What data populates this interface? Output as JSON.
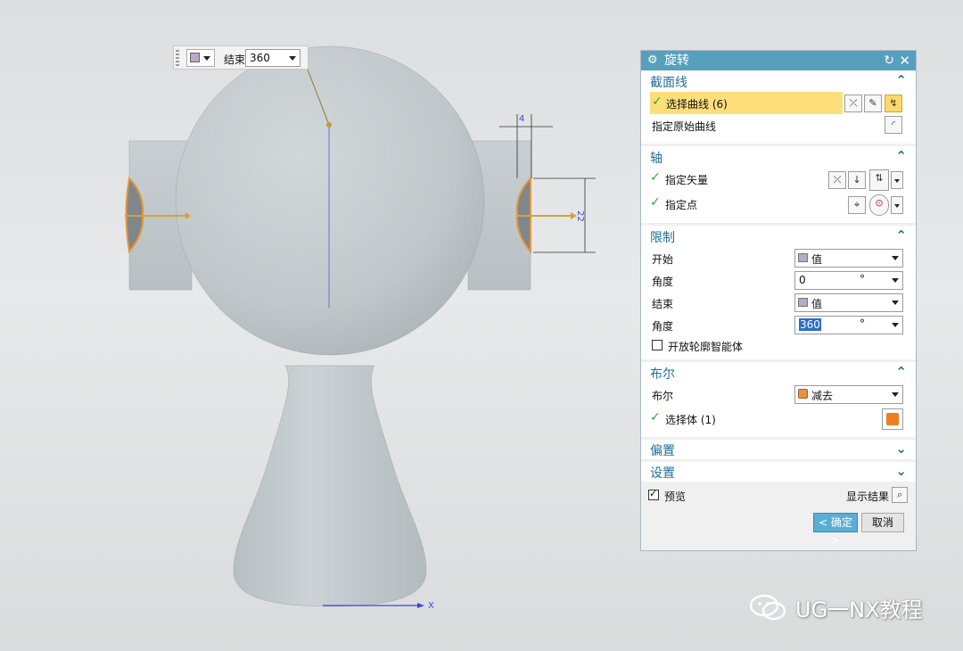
{
  "mini_toolbar": {
    "label": "结束",
    "value": "360"
  },
  "dimensions": {
    "width_dim": "4",
    "height_dim": "22",
    "axis_label": "X"
  },
  "dialog": {
    "title": "旋转",
    "sections": {
      "section_curve": {
        "title": "截面线",
        "select_curve": "选择曲线 (6)",
        "specify_origin": "指定原始曲线"
      },
      "axis": {
        "title": "轴",
        "specify_vector": "指定矢量",
        "specify_point": "指定点"
      },
      "limits": {
        "title": "限制",
        "start_label": "开始",
        "start_type": "值",
        "start_angle_label": "角度",
        "start_angle": "0",
        "end_label": "结束",
        "end_type": "值",
        "end_angle_label": "角度",
        "end_angle": "360",
        "unit": "°",
        "open_profile": "开放轮廓智能体"
      },
      "boolean": {
        "title": "布尔",
        "bool_label": "布尔",
        "bool_value": "减去",
        "select_body": "选择体 (1)"
      },
      "offset": {
        "title": "偏置"
      },
      "settings": {
        "title": "设置"
      }
    },
    "preview_label": "预览",
    "show_result": "显示结果",
    "ok_button": "< 确定 >",
    "cancel_button": "取消"
  },
  "watermark": {
    "text": "UG一NX教程"
  },
  "colors": {
    "title_bar": "#56a0bd",
    "highlight": "#fddf7a",
    "section_title": "#1f6f9a",
    "model": "#c7cdd0"
  }
}
